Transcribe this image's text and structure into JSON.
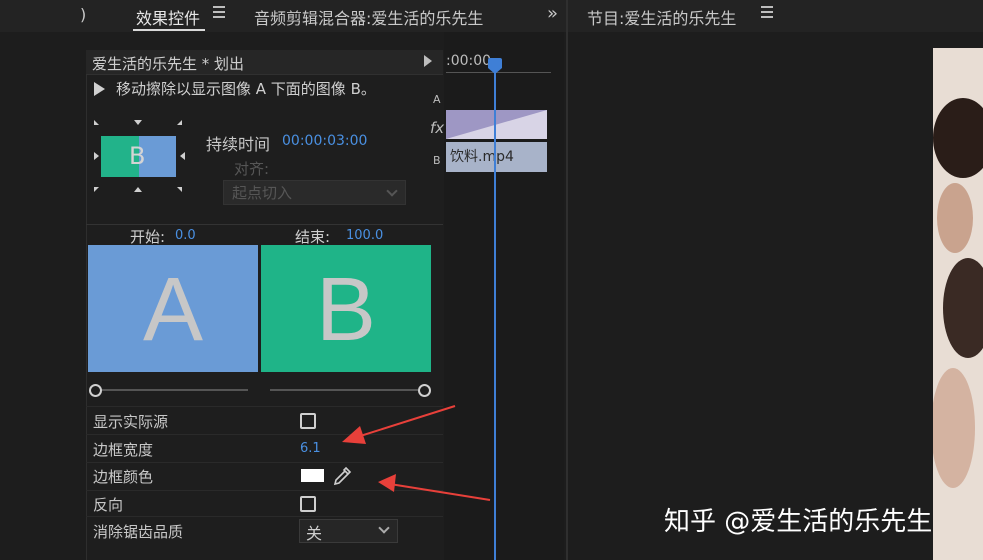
{
  "tabs": {
    "left_stub": ")",
    "effect_controls": "效果控件",
    "audio_mixer": "音频剪辑混合器:爱生活的乐先生",
    "program": "节目:爱生活的乐先生",
    "overflow": "»"
  },
  "effect_panel": {
    "clip_name": "爱生活的乐先生 * 划出",
    "description": "移动擦除以显示图像 A 下面的图像 B。",
    "preview_letter": "B",
    "duration_label": "持续时间",
    "duration_value": "00:00:03:00",
    "align_label": "对齐:",
    "align_value": "起点切入",
    "start_label": "开始:",
    "start_value": "0.0",
    "end_label": "结束:",
    "end_value": "100.0",
    "letter_a": "A",
    "letter_b": "B",
    "properties": {
      "show_actual_source": "显示实际源",
      "border_width": "边框宽度",
      "border_width_value": "6.1",
      "border_color": "边框颜色",
      "reverse": "反向",
      "anti_alias": "消除锯齿品质",
      "anti_alias_value": "关"
    }
  },
  "timeline": {
    "time": ":00:00",
    "track_a": "A",
    "track_fx": "fx",
    "track_b": "B",
    "clip_name": "饮料.mp4"
  },
  "watermark": "知乎 @爱生活的乐先生",
  "colors": {
    "accent_blue": "#4a90e2",
    "image_a": "#6a9bd6",
    "image_b": "#1fb488",
    "annotation_arrow": "#e8403a"
  }
}
